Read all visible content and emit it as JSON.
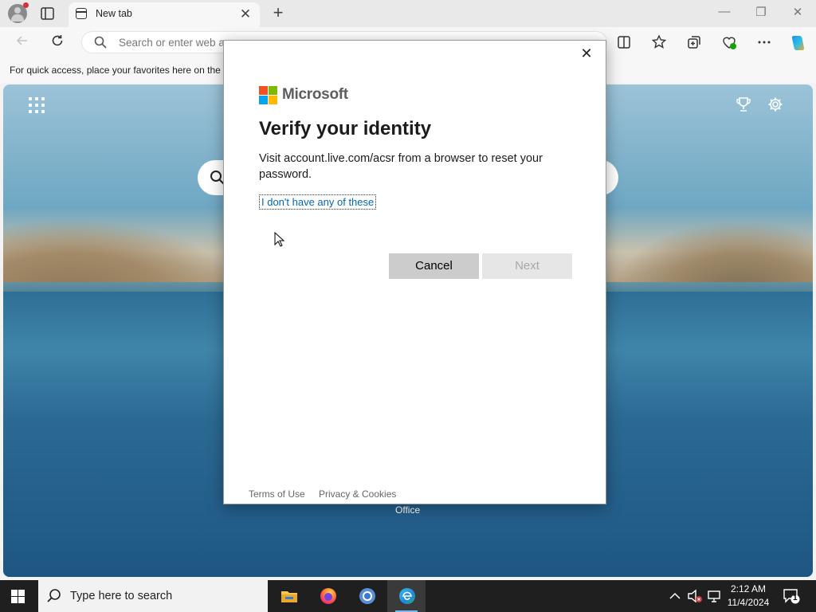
{
  "browser": {
    "tab_title": "New tab",
    "tab_close": "✕",
    "new_tab": "+",
    "win_minimize": "—",
    "win_restore": "❐",
    "win_close": "✕",
    "address_placeholder": "Search or enter web a",
    "favorites_hint": "For quick access, place your favorites here on the"
  },
  "new_tab_page": {
    "office_label": "Office"
  },
  "dialog": {
    "close": "✕",
    "brand": "Microsoft",
    "title": "Verify your identity",
    "message": "Visit account.live.com/acsr from a browser to reset your password.",
    "link": "I don't have any of these",
    "cancel": "Cancel",
    "next": "Next",
    "footer_terms": "Terms of Use",
    "footer_privacy": "Privacy & Cookies",
    "brand_colors": [
      "#f25022",
      "#7fba00",
      "#00a4ef",
      "#ffb900"
    ]
  },
  "taskbar": {
    "search_placeholder": "Type here to search",
    "time": "2:12 AM",
    "date": "11/4/2024",
    "notification_count": "1",
    "apps": [
      "file-explorer",
      "firefox",
      "chrome",
      "edge"
    ]
  }
}
